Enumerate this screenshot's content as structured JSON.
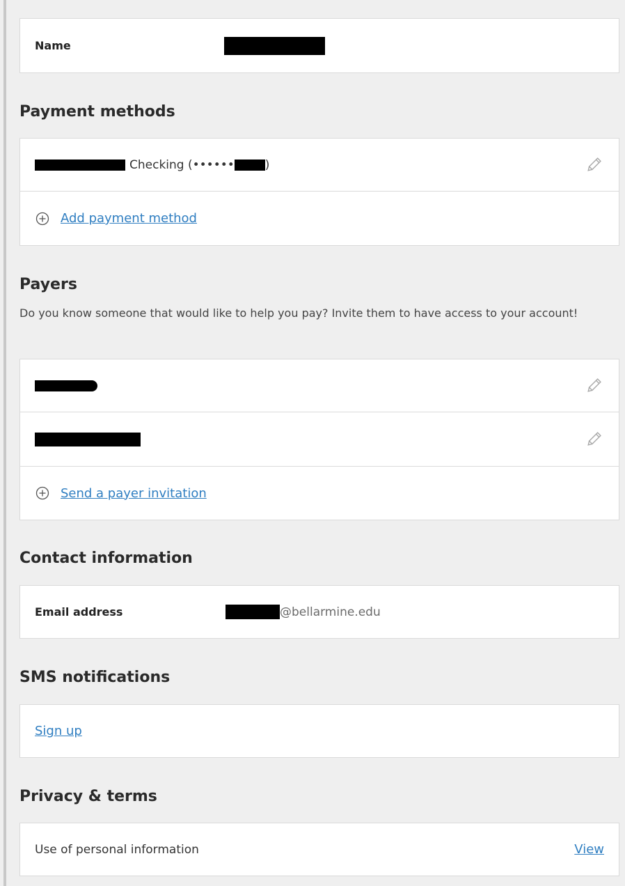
{
  "name_section": {
    "label": "Name",
    "value_redacted": true
  },
  "payment_methods": {
    "title": "Payment methods",
    "items": [
      {
        "account_type": "Checking (••••••",
        "closing": ")",
        "icon": "pencil-icon"
      }
    ],
    "add_label": "Add payment method"
  },
  "payers": {
    "title": "Payers",
    "description": "Do you know someone that would like to help you pay? Invite them to have access to your account!",
    "items": [
      {
        "icon": "pencil-icon"
      },
      {
        "icon": "pencil-icon"
      }
    ],
    "add_label": "Send a payer invitation"
  },
  "contact": {
    "title": "Contact information",
    "email_label": "Email address",
    "email_domain": "@bellarmine.edu"
  },
  "sms": {
    "title": "SMS notifications",
    "signup_label": "Sign up"
  },
  "privacy": {
    "title": "Privacy & terms",
    "row_label": "Use of personal information",
    "view_label": "View"
  },
  "colors": {
    "background": "#efefef",
    "card": "#ffffff",
    "border": "#dadada",
    "link": "#2f7ec1",
    "redaction": "#000000"
  }
}
